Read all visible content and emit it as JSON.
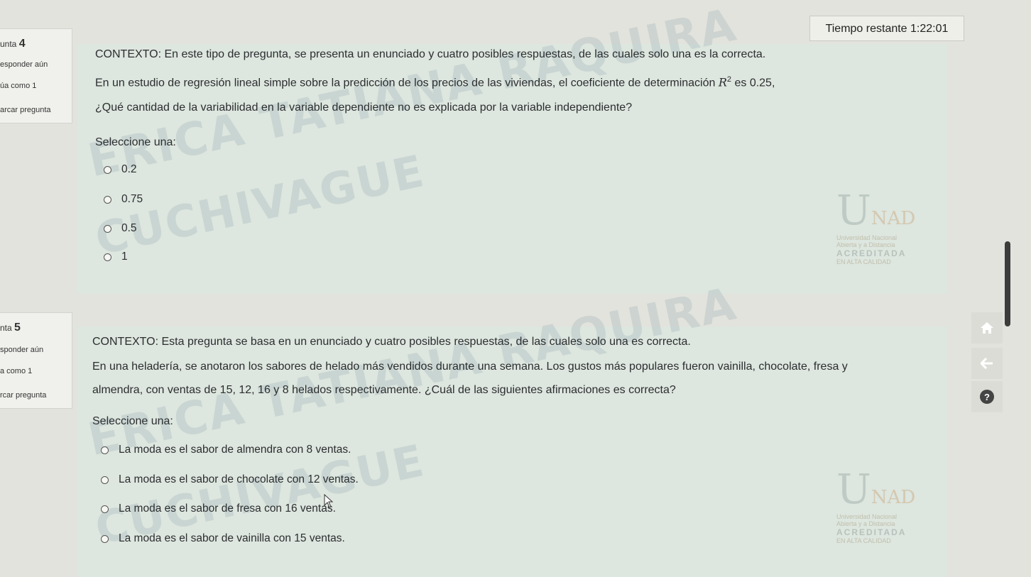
{
  "timer": {
    "label": "Tiempo restante",
    "value": "1:22:01"
  },
  "q4": {
    "number_prefix": "unta",
    "number": "4",
    "status": "esponder aún",
    "points": "úa como 1",
    "flag": "arcar pregunta",
    "context": "CONTEXTO: En este tipo de pregunta, se presenta un enunciado y cuatro posibles respuestas, de las cuales solo una es la correcta.",
    "stem_line1_a": "En un estudio de regresión lineal simple sobre la predicción de los precios de las viviendas, el coeficiente de determinación",
    "stem_symbol": "R",
    "stem_exp": "2",
    "stem_line1_b": "es 0.25,",
    "stem_line2": "¿Qué cantidad de la variabilidad en la variable dependiente no es explicada por la variable independiente?",
    "select_label": "Seleccione una:",
    "options": [
      "0.2",
      "0.75",
      "0.5",
      "1"
    ],
    "watermark1": "ERICA TATIANA RAQUIRA",
    "watermark2": "CUCHIVAGUE"
  },
  "q5": {
    "number_prefix": "nta",
    "number": "5",
    "status": "sponder aún",
    "points": "a como 1",
    "flag": "rcar pregunta",
    "context": "CONTEXTO: Esta pregunta se basa en un enunciado y cuatro posibles respuestas, de las cuales solo una es correcta.",
    "stem_line1": "En una heladería, se anotaron los sabores de helado más vendidos durante una semana. Los gustos más populares fueron vainilla, chocolate, fresa y",
    "stem_line2": "almendra, con ventas de 15, 12, 16 y 8 helados respectivamente. ¿Cuál de las siguientes afirmaciones es correcta?",
    "select_label": "Seleccione una:",
    "options": [
      "La moda es el sabor de almendra con 8 ventas.",
      "La moda es el sabor de chocolate con 12 ventas.",
      "La moda es el sabor de fresa con 16 ventas.",
      "La moda es el sabor de vainilla con 15 ventas."
    ],
    "watermark1": "ERICA TATIANA RAQUIRA",
    "watermark2": "CUCHIVAGUE"
  },
  "logo": {
    "brand_u": "U",
    "brand_nad": "NAD",
    "line1": "Universidad Nacional",
    "line2": "Abierta y a Distancia",
    "accredit": "ACREDITADA",
    "accredit2": "EN ALTA CALIDAD"
  },
  "nav": {
    "home_icon": "home-icon",
    "back_icon": "arrow-left-icon",
    "help_icon": "help-icon",
    "help_glyph": "?"
  }
}
